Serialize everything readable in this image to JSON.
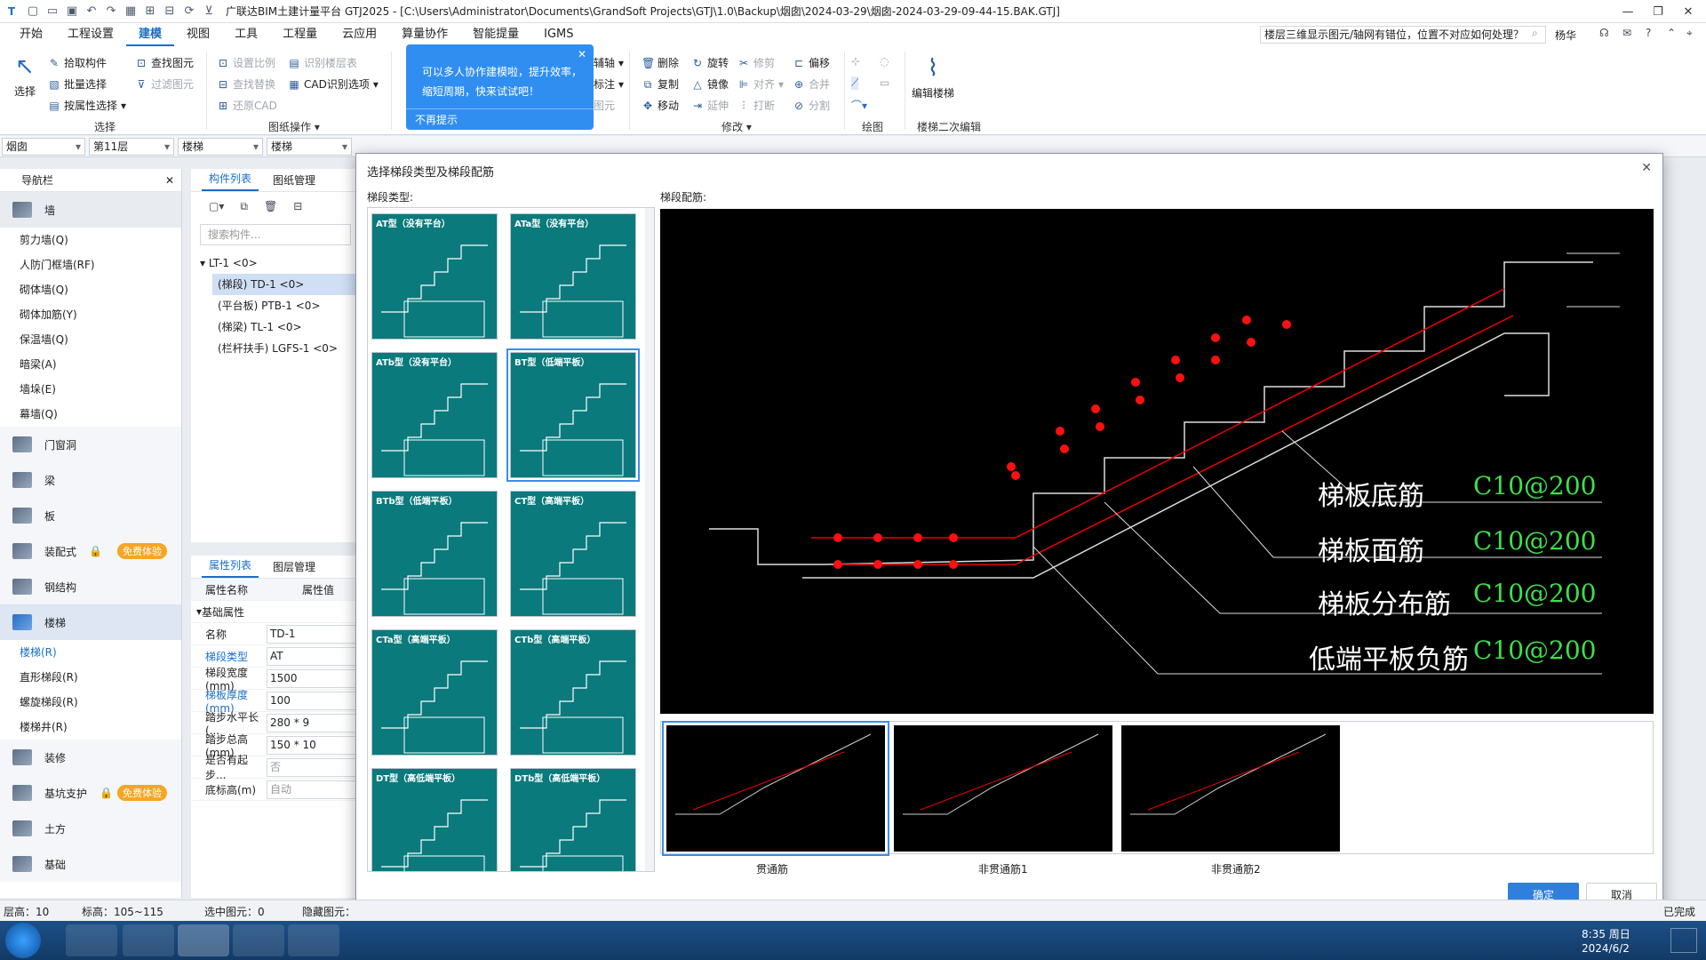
{
  "titlebar": {
    "title": "广联达BIM土建计量平台 GTJ2025 - [C:\\Users\\Administrator\\Documents\\GrandSoft Projects\\GTJ\\1.0\\Backup\\烟囱\\2024-03-29\\烟囱-2024-03-29-09-44-15.BAK.GTJ]"
  },
  "menubar": {
    "items": [
      "开始",
      "工程设置",
      "建模",
      "视图",
      "工具",
      "工程量",
      "云应用",
      "算量协作",
      "智能提量",
      "IGMS"
    ],
    "question": "楼层三维显示图元/轴网有错位，位置不对应如何处理？",
    "user": "杨华"
  },
  "ribbon": {
    "select": "选择",
    "pick": "拾取构件",
    "batch": "批量选择",
    "byattr": "按属性选择",
    "find": "查找图元",
    "filter": "过滤图元",
    "grp_select": "选择",
    "scale": "设置比例",
    "findrep": "查找替换",
    "restore": "还原CAD",
    "idlayer": "识别楼层表",
    "cadopt": "CAD识别选项",
    "grp_drawing": "图纸操作",
    "aux": "辅轴",
    "annot": "标注",
    "elem": "图元",
    "del": "删除",
    "rotate": "旋转",
    "trim": "修剪",
    "offset": "偏移",
    "copy": "复制",
    "mirror": "镜像",
    "align": "对齐",
    "merge": "合并",
    "move": "移动",
    "extend": "延伸",
    "break": "打断",
    "split": "分割",
    "grp_modify": "修改",
    "grp_draw": "绘图",
    "edit_stair": "编辑楼梯",
    "grp_stair": "楼梯二次编辑"
  },
  "popup": {
    "line1": "可以多人协作建模啦，提升效率，",
    "line2": "缩短周期，快来试试吧！",
    "dismiss": "不再提示"
  },
  "filterbar": {
    "project": "烟囱",
    "floor": "第11层",
    "cat": "楼梯",
    "sub": "楼梯"
  },
  "nav": {
    "title": "导航栏",
    "wall": "墙",
    "wall_items": [
      "剪力墙(Q)",
      "人防门框墙(RF)",
      "砌体墙(Q)",
      "砌体加筋(Y)",
      "保温墙(Q)",
      "暗梁(A)",
      "墙垛(E)",
      "幕墙(Q)"
    ],
    "cats": [
      "门窗洞",
      "梁",
      "板",
      "装配式",
      "钢结构",
      "楼梯"
    ],
    "stair_items": [
      "楼梯(R)",
      "直形梯段(R)",
      "螺旋梯段(R)",
      "楼梯井(R)"
    ],
    "cats2": [
      "装修",
      "基坑支护",
      "土方",
      "基础"
    ],
    "free": "免费体验"
  },
  "comp": {
    "tab1": "构件列表",
    "tab2": "图纸管理",
    "search": "搜索构件...",
    "root": "LT-1 <0>",
    "items": [
      "(梯段) TD-1 <0>",
      "(平台板) PTB-1 <0>",
      "(梯梁) TL-1 <0>",
      "(栏杆扶手) LGFS-1 <0>"
    ]
  },
  "props": {
    "tab1": "属性列表",
    "tab2": "图层管理",
    "col1": "属性名称",
    "col2": "属性值",
    "group": "基础属性",
    "rows": [
      {
        "n": "名称",
        "v": "TD-1"
      },
      {
        "n": "梯段类型",
        "v": "AT"
      },
      {
        "n": "梯段宽度(mm)",
        "v": "1500"
      },
      {
        "n": "梯板厚度(mm)",
        "v": "100"
      },
      {
        "n": "踏步水平长(...",
        "v": "280 * 9"
      },
      {
        "n": "踏步总高(mm)",
        "v": "150 * 10"
      },
      {
        "n": "是否有起步...",
        "v": "否"
      },
      {
        "n": "底标高(m)",
        "v": "自动"
      }
    ]
  },
  "dialog": {
    "title": "选择梯段类型及梯段配筋",
    "types_label": "梯段类型:",
    "rebar_label": "梯段配筋:",
    "types": [
      "AT型（没有平台）",
      "ATa型（没有平台）",
      "ATb型（没有平台）",
      "BT型（低端平板）",
      "BTb型（低端平板）",
      "CT型（高端平板）",
      "CTa型（高端平板）",
      "CTb型（高端平板）",
      "DT型（高低端平板）",
      "DTb型（高低端平板）"
    ],
    "preview": {
      "labels": [
        "梯板底筋",
        "梯板面筋",
        "梯板分布筋",
        "低端平板负筋"
      ],
      "values": [
        "C10@200",
        "C10@200",
        "C10@200",
        "C10@200"
      ]
    },
    "rebar_options": [
      "贯通筋",
      "非贯通筋1",
      "非贯通筋2"
    ],
    "ok": "确定",
    "cancel": "取消"
  },
  "statusbar": {
    "floor_h": "层高：10",
    "elev": "标高：105~115",
    "selected": "选中图元：0",
    "hidden": "隐藏图元：",
    "done": "已完成"
  },
  "taskbar": {
    "time": "8:35 周日",
    "date": "2024/6/2"
  }
}
